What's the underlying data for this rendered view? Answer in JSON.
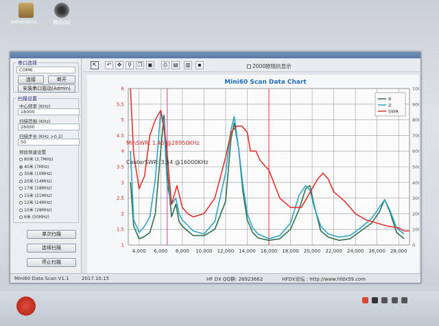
{
  "desktop": {
    "icons": [
      {
        "label": "Administra...",
        "icon": "user-folder-icon"
      },
      {
        "label": "腾讯QQ",
        "icon": "qq-icon"
      }
    ]
  },
  "sidebar": {
    "port_group": {
      "label": "串口选择",
      "port_value": "COM6",
      "connect_label": "连接",
      "disconnect_label": "断开",
      "install_driver_label": "安装串口驱动(Admin)"
    },
    "scan_group": {
      "label": "扫描设置",
      "center_freq_label": "中心频率 (KHz)",
      "center_freq_value": "16000",
      "range_label": "扫描范围 (KHz)",
      "range_value": "26000",
      "step_label": "扫描步长 (KHz >0.2)",
      "step_value": "50",
      "quick_label": "频段快速设置",
      "bands": [
        {
          "label": "80米 (3.7MHz)",
          "selected": false
        },
        {
          "label": "40米 (7MHz)",
          "selected": true
        },
        {
          "label": "30米 (10MHz)",
          "selected": false
        },
        {
          "label": "20米 (14MHz)",
          "selected": false
        },
        {
          "label": "17米 (18MHz)",
          "selected": false
        },
        {
          "label": "15米 (21MHz)",
          "selected": false
        },
        {
          "label": "12米 (24MHz)",
          "selected": false
        },
        {
          "label": "10米 (28MHz)",
          "selected": false
        },
        {
          "label": "6米 (50MHz)",
          "selected": false
        }
      ]
    },
    "single_scan_label": "单次扫描",
    "continuous_scan_label": "连续扫描",
    "stop_scan_label": "停止扫描"
  },
  "toolbar": {
    "tools": [
      "select-icon",
      "undo-icon",
      "move-icon",
      "zoom-icon",
      "copy-icon",
      "save-image-icon",
      "print-icon",
      "print-preview-icon",
      "export-icon",
      "disk-icon"
    ],
    "checkbox_label": "2000欧阻抗显示"
  },
  "status": {
    "app_name": "Mini60 Data Scan V1.1",
    "date": "2017.10.15",
    "qq": "HF DX QQ群: 26923662",
    "forum": "HFDX论坛 : http://www.hfdx59.com"
  },
  "colors": {
    "r_series": "#2c6f4a",
    "z_series": "#2aa3c8",
    "swr_series": "#e2312e",
    "marker_min": "#e2312e",
    "marker_center": "#d33a9a"
  },
  "chart_data": {
    "type": "line",
    "title": "Mini60 Scan Data Chart",
    "xlim": [
      3000,
      29000
    ],
    "ylim_left": [
      1,
      6
    ],
    "ylim_right": [
      0,
      1000
    ],
    "x_ticks": [
      "4,000",
      "6,000",
      "8,000",
      "10,000",
      "12,000",
      "14,000",
      "16,000",
      "18,000",
      "20,000",
      "22,000",
      "24,000",
      "26,000",
      "28,000"
    ],
    "y_ticks_left": [
      "1",
      "1.5",
      "2",
      "2.5",
      "3",
      "3.5",
      "4",
      "4.5",
      "5",
      "5.5",
      "6"
    ],
    "y_ticks_right": [
      "0",
      "100",
      "200",
      "300",
      "400",
      "500",
      "600",
      "700",
      "800",
      "900",
      "1000"
    ],
    "legend": {
      "position": "top-right"
    },
    "annotations": [
      "MinSWR: 1.45 @28950KHz",
      "CenterSWR: 3.54 @16000KHz"
    ],
    "markers_x": [
      6600,
      16000
    ],
    "series": [
      {
        "name": "R",
        "axis": "right",
        "x": [
          3200,
          3500,
          4000,
          4500,
          5000,
          5500,
          6000,
          6300,
          6600,
          7000,
          7400,
          7700,
          8000,
          9000,
          10000,
          11000,
          12000,
          12500,
          12800,
          13200,
          13600,
          14000,
          14500,
          15000,
          16000,
          17000,
          18000,
          18800,
          19400,
          19800,
          20200,
          20800,
          21500,
          22500,
          23500,
          24500,
          25500,
          26200,
          26700,
          27200,
          27800,
          28500
        ],
        "values": [
          400,
          120,
          40,
          55,
          80,
          200,
          600,
          830,
          480,
          180,
          260,
          150,
          120,
          60,
          60,
          100,
          280,
          680,
          780,
          620,
          340,
          160,
          80,
          45,
          30,
          40,
          100,
          230,
          360,
          380,
          250,
          90,
          50,
          30,
          40,
          90,
          140,
          210,
          290,
          210,
          80,
          40
        ]
      },
      {
        "name": "Z",
        "axis": "right",
        "x": [
          3200,
          3500,
          4000,
          4500,
          5000,
          5500,
          6000,
          6300,
          6600,
          7000,
          7400,
          7700,
          8000,
          9000,
          10000,
          11000,
          12000,
          12500,
          12800,
          13200,
          13600,
          14000,
          14500,
          15000,
          16000,
          17000,
          18000,
          18800,
          19400,
          19800,
          20200,
          20800,
          21500,
          22500,
          23500,
          24500,
          25500,
          26200,
          26700,
          27200,
          27800,
          28500
        ],
        "values": [
          600,
          160,
          80,
          120,
          180,
          420,
          860,
          780,
          380,
          260,
          300,
          200,
          160,
          90,
          70,
          150,
          460,
          740,
          820,
          620,
          380,
          200,
          110,
          70,
          40,
          60,
          140,
          320,
          380,
          350,
          240,
          120,
          70,
          50,
          60,
          110,
          170,
          240,
          290,
          220,
          110,
          70
        ]
      },
      {
        "name": "SWR",
        "axis": "left",
        "x": [
          3200,
          3500,
          4000,
          4500,
          5000,
          5500,
          6000,
          6500,
          7000,
          7500,
          8000,
          8500,
          9000,
          10000,
          11000,
          12000,
          12500,
          13000,
          13500,
          14000,
          14300,
          14800,
          15200,
          15700,
          16000,
          17000,
          18000,
          19000,
          20000,
          20500,
          21000,
          21500,
          22000,
          23000,
          24000,
          25000,
          26000,
          27000,
          28000,
          28500,
          29000
        ],
        "values": [
          6,
          3.9,
          2.8,
          3.2,
          4.5,
          5.0,
          5.3,
          4.3,
          2.3,
          2.9,
          2.2,
          2.0,
          1.9,
          2.0,
          2.5,
          3.8,
          4.6,
          4.8,
          4.8,
          4.6,
          4.0,
          4.0,
          3.7,
          3.5,
          3.4,
          2.5,
          2.2,
          2.2,
          2.8,
          3.1,
          3.3,
          3.1,
          2.7,
          2.4,
          2.0,
          1.8,
          1.7,
          1.6,
          1.55,
          1.45,
          1.45
        ]
      }
    ]
  }
}
